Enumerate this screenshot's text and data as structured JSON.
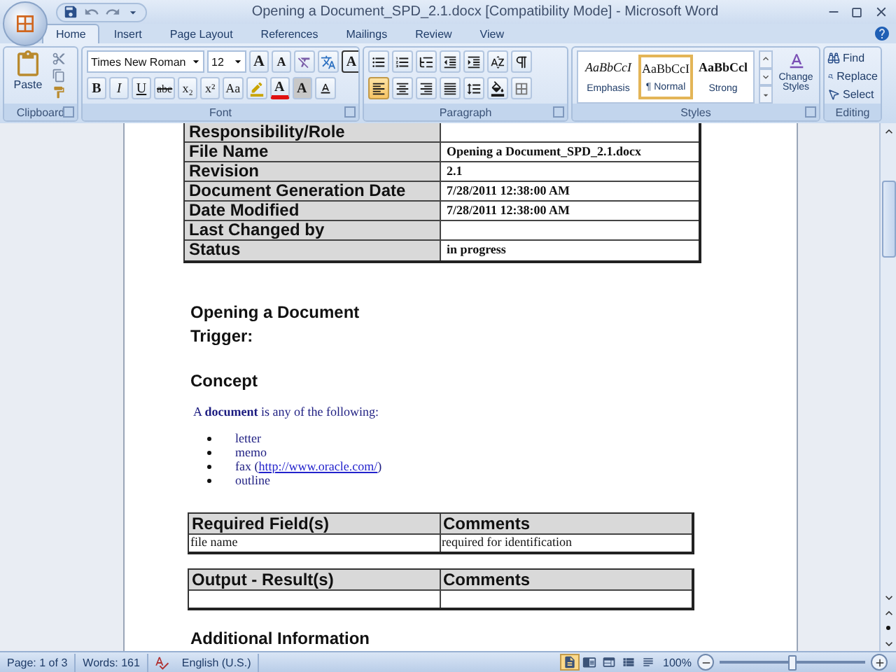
{
  "window": {
    "title": "Opening a Document_SPD_2.1.docx [Compatibility Mode] - Microsoft Word"
  },
  "tabs": [
    {
      "label": "Home",
      "selected": true
    },
    {
      "label": "Insert",
      "selected": false
    },
    {
      "label": "Page Layout",
      "selected": false
    },
    {
      "label": "References",
      "selected": false
    },
    {
      "label": "Mailings",
      "selected": false
    },
    {
      "label": "Review",
      "selected": false
    },
    {
      "label": "View",
      "selected": false
    }
  ],
  "ribbon": {
    "clipboard": {
      "label": "Clipboard",
      "paste": "Paste"
    },
    "font": {
      "label": "Font",
      "name": "Times New Roman",
      "size": "12",
      "size_buttons": [
        "A",
        "A"
      ],
      "boxed": "A",
      "format_buttons": [
        {
          "label": "B",
          "kind": "bold"
        },
        {
          "label": "I",
          "kind": "italic"
        },
        {
          "label": "U",
          "kind": "underline"
        },
        {
          "label": "abe",
          "kind": "strike"
        },
        {
          "label": "x₂",
          "kind": "sub"
        },
        {
          "label": "x²",
          "kind": "sup"
        },
        {
          "label": "Aa",
          "kind": "case"
        }
      ],
      "text_color_button": "A",
      "shading": "A"
    },
    "paragraph": {
      "label": "Paragraph",
      "alignments": [
        {
          "kind": "left",
          "selected": true
        },
        {
          "kind": "center",
          "selected": false
        },
        {
          "kind": "right",
          "selected": false
        },
        {
          "kind": "justify",
          "selected": false
        }
      ]
    },
    "styles": {
      "label": "Styles",
      "items": [
        {
          "preview": "AaBbCcI",
          "name": "Emphasis",
          "kind": "emphasis",
          "selected": false
        },
        {
          "preview": "AaBbCcI",
          "name": "¶ Normal",
          "kind": "normal",
          "selected": true
        },
        {
          "preview": "AaBbCcl",
          "name": "Strong",
          "kind": "strong",
          "selected": false
        }
      ],
      "change": [
        "Change",
        "Styles"
      ]
    },
    "editing": {
      "label": "Editing",
      "items": [
        {
          "kind": "find",
          "label": "Find"
        },
        {
          "kind": "replace",
          "label": "Replace"
        },
        {
          "kind": "select",
          "label": "Select"
        }
      ]
    }
  },
  "document": {
    "info_table": [
      {
        "label": "Responsibility/Role"
      },
      {
        "label": "File Name",
        "value": "Opening a Document_SPD_2.1.docx"
      },
      {
        "label": "Revision",
        "value": "2.1"
      },
      {
        "label": "Document Generation Date",
        "value": "7/28/2011 12:38:00 AM"
      },
      {
        "label": "Date Modified",
        "value": "7/28/2011 12:38:00 AM"
      },
      {
        "label": "Last Changed by"
      },
      {
        "label": "Status",
        "value": "in progress"
      }
    ],
    "heading": "Opening a Document",
    "trigger": "Trigger:",
    "concept": "Concept",
    "intro": "A **document** is any of the following:",
    "bullets": [
      {
        "text": "letter"
      },
      {
        "text": "memo"
      },
      {
        "text": "fax (",
        "link": "http://www.oracle.com/",
        "after": ")"
      },
      {
        "text": "outline"
      }
    ],
    "tables": [
      {
        "columns": [
          "Required Field(s)",
          "Comments"
        ],
        "rows": [
          {
            "cells": [
              "file name",
              "required for identification"
            ]
          }
        ]
      },
      {
        "columns": [
          "Output - Result(s)",
          "Comments"
        ],
        "rows": [
          {
            "blank": true
          }
        ]
      }
    ],
    "next_heading": "Additional Information"
  },
  "status_bar": {
    "page": "Page: 1 of 3",
    "words": "Words: 161",
    "language": "English (U.S.)",
    "views": [
      {
        "kind": "print",
        "selected": true
      },
      {
        "kind": "reading",
        "selected": false
      },
      {
        "kind": "web",
        "selected": false
      },
      {
        "kind": "outline",
        "selected": false
      },
      {
        "kind": "draft",
        "selected": false
      }
    ],
    "zoom": "100%",
    "zoom_slider": {
      "level": 0.5
    }
  }
}
